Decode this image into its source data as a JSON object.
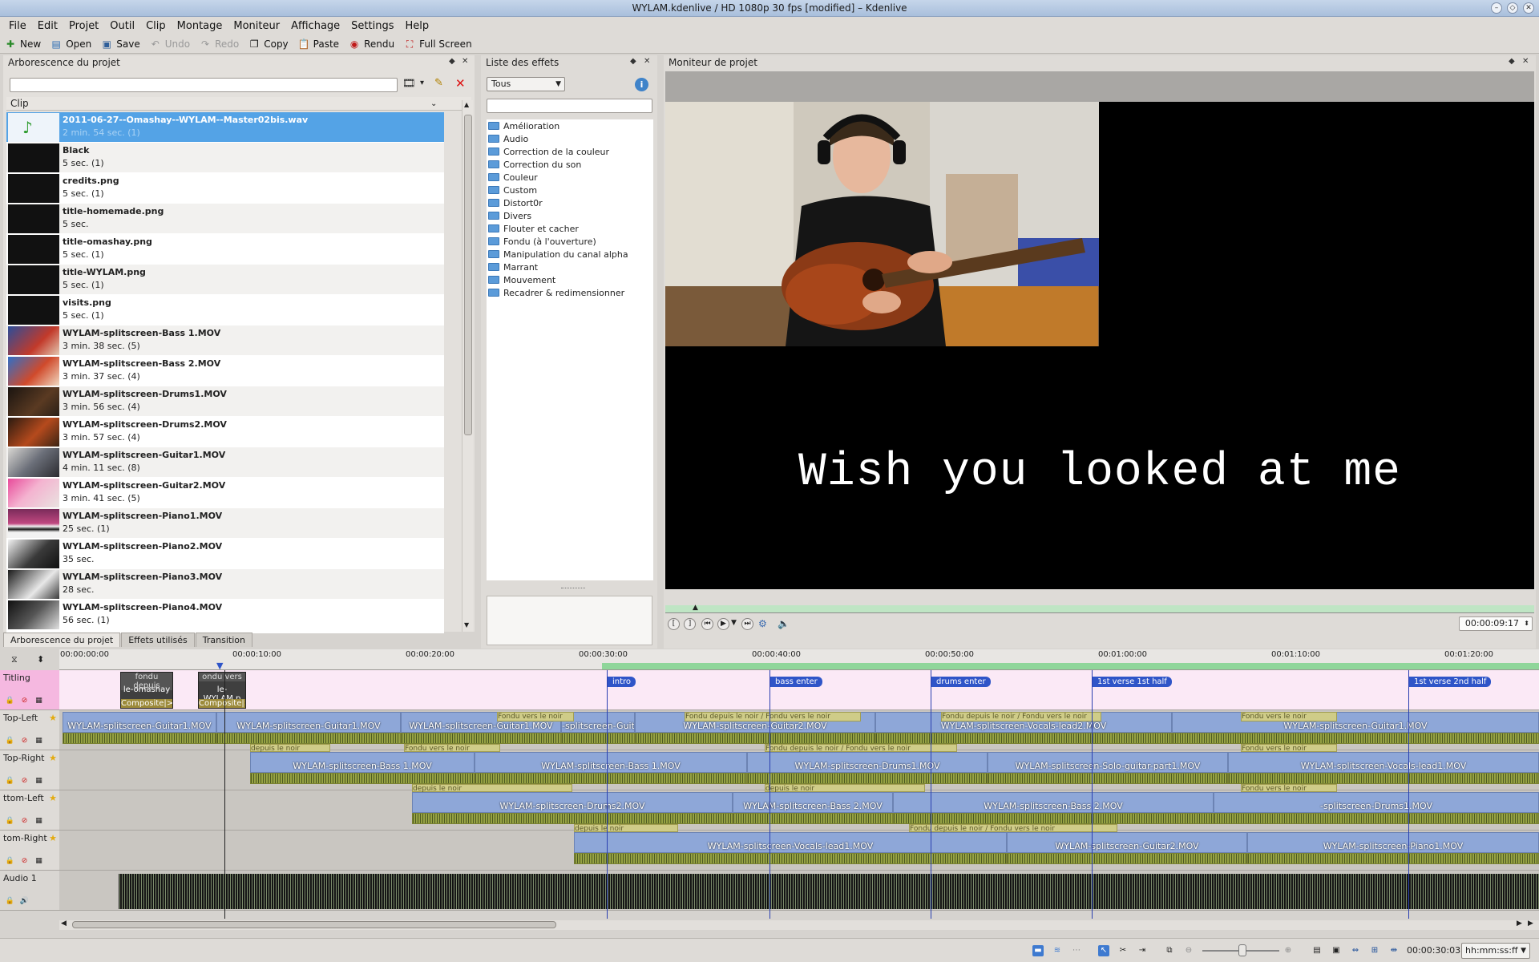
{
  "window": {
    "title": "WYLAM.kdenlive / HD 1080p 30 fps [modified] – Kdenlive"
  },
  "menu": [
    "File",
    "Edit",
    "Projet",
    "Outil",
    "Clip",
    "Montage",
    "Moniteur",
    "Affichage",
    "Settings",
    "Help"
  ],
  "toolbar": {
    "new": "New",
    "open": "Open",
    "save": "Save",
    "undo": "Undo",
    "redo": "Redo",
    "copy": "Copy",
    "paste": "Paste",
    "render": "Rendu",
    "fullscreen": "Full Screen"
  },
  "project": {
    "title": "Arborescence du projet",
    "column": "Clip",
    "clips": [
      {
        "name": "2011-06-27--Omashay--WYLAM--Master02bis.wav",
        "dur": "2 min. 54 sec. (1)"
      },
      {
        "name": "Black",
        "dur": "5 sec. (1)"
      },
      {
        "name": "credits.png",
        "dur": "5 sec. (1)"
      },
      {
        "name": "title-homemade.png",
        "dur": "5 sec."
      },
      {
        "name": "title-omashay.png",
        "dur": "5 sec. (1)"
      },
      {
        "name": "title-WYLAM.png",
        "dur": "5 sec. (1)"
      },
      {
        "name": "visits.png",
        "dur": "5 sec. (1)"
      },
      {
        "name": "WYLAM-splitscreen-Bass 1.MOV",
        "dur": "3 min. 38 sec. (5)"
      },
      {
        "name": "WYLAM-splitscreen-Bass 2.MOV",
        "dur": "3 min. 37 sec. (4)"
      },
      {
        "name": "WYLAM-splitscreen-Drums1.MOV",
        "dur": "3 min. 56 sec. (4)"
      },
      {
        "name": "WYLAM-splitscreen-Drums2.MOV",
        "dur": "3 min. 57 sec. (4)"
      },
      {
        "name": "WYLAM-splitscreen-Guitar1.MOV",
        "dur": "4 min. 11 sec. (8)"
      },
      {
        "name": "WYLAM-splitscreen-Guitar2.MOV",
        "dur": "3 min. 41 sec. (5)"
      },
      {
        "name": "WYLAM-splitscreen-Piano1.MOV",
        "dur": "25 sec. (1)"
      },
      {
        "name": "WYLAM-splitscreen-Piano2.MOV",
        "dur": "35 sec."
      },
      {
        "name": "WYLAM-splitscreen-Piano3.MOV",
        "dur": "28 sec."
      },
      {
        "name": "WYLAM-splitscreen-Piano4.MOV",
        "dur": "56 sec. (1)"
      }
    ],
    "tabs": [
      "Arborescence du projet",
      "Effets utilisés",
      "Transition"
    ]
  },
  "effects": {
    "title": "Liste des effets",
    "filter": "Tous",
    "items": [
      "Amélioration",
      "Audio",
      "Correction de la couleur",
      "Correction du son",
      "Couleur",
      "Custom",
      "Distort0r",
      "Divers",
      "Flouter et cacher",
      "Fondu (à l'ouverture)",
      "Manipulation du canal alpha",
      "Marrant",
      "Mouvement",
      "Recadrer & redimensionner"
    ]
  },
  "monitor": {
    "title": "Moniteur de projet",
    "overlay": "Wish you looked at me",
    "timecode": "00:00:09:17"
  },
  "timeline": {
    "ruler": [
      "00:00:00:00",
      "00:00:10:00",
      "00:00:20:00",
      "00:00:30:00",
      "00:00:40:00",
      "00:00:50:00",
      "00:01:00:00",
      "00:01:10:00",
      "00:01:20:00"
    ],
    "markers": [
      "intro",
      "bass enter",
      "drums enter",
      "1st verse 1st half",
      "1st verse 2nd half"
    ],
    "tracks": [
      "Titling",
      "Top-Left",
      "Top-Right",
      "ttom-Left",
      "tom-Right",
      "Audio 1"
    ],
    "titling_clips": [
      {
        "a": "fondu depuis",
        "b": "le-omashay",
        "c": "Composite|>"
      },
      {
        "a": "ondu vers",
        "b": "le-WYLAM.p",
        "c": "Composite|>"
      }
    ],
    "clips_topleft": [
      "WYLAM-splitscreen-Guitar1.MOV",
      "WYLAM-splitscreen-Guitar1.MOV",
      "WYLAM-splitscreen-Guitar1.MOV",
      "-splitscreen-Guit",
      "WYLAM-splitscreen-Guitar2.MOV",
      "WYLAM-splitscreen-Vocals-lead2.MOV",
      "WYLAM-splitscreen-Guitar1.MOV"
    ],
    "clips_topright": [
      "WYLAM-splitscreen-Bass 1.MOV",
      "WYLAM-splitscreen-Bass 1.MOV",
      "WYLAM-splitscreen-Drums1.MOV",
      "WYLAM-splitscreen-Solo-guitar-part1.MOV",
      "WYLAM-splitscreen-Vocals-lead1.MOV"
    ],
    "clips_bottomleft": [
      "WYLAM-splitscreen-Drums2.MOV",
      "WYLAM-splitscreen-Bass 2.MOV",
      "WYLAM-splitscreen-Bass 2.MOV",
      "-splitscreen-Drums1.MOV"
    ],
    "clips_bottomright": [
      "WYLAM-splitscreen-Vocals-lead1.MOV",
      "WYLAM-splitscreen-Guitar2.MOV",
      "WYLAM-splitscreen-Piano1.MOV"
    ],
    "trans_fondu_vers": "Fondu vers le noir",
    "trans_fondu_depuis": "Fondu depuis le noir / Fondu vers le noir",
    "trans_depuis": "depuis le noir"
  },
  "status": {
    "time": "00:00:30:03",
    "format": "hh:mm:ss:ff"
  }
}
